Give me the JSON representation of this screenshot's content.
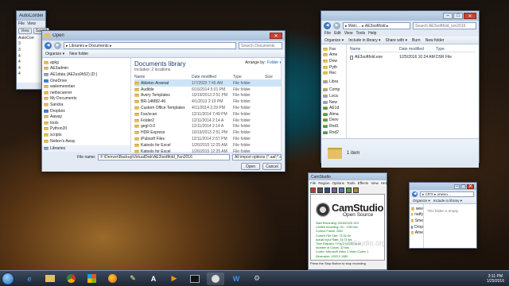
{
  "aux_window": {
    "title": "AutoCorder",
    "menu": [
      "File",
      "View"
    ],
    "tabs": [
      "View",
      "Saved"
    ],
    "tree": [
      "AutoCorr",
      "3",
      "3",
      "4",
      "4",
      "4",
      "4"
    ]
  },
  "open_dialog": {
    "title": "Open",
    "breadcrumb": "▸ Libraries ▸ Documents ▸",
    "search_placeholder": "Search Documents",
    "toolbar": {
      "organize": "Organize ▾",
      "new_folder": "New folder"
    },
    "nav_items": [
      "apkg",
      "AE3admin",
      "AE1data (AE2us9h52) (D:)",
      "OneDrive",
      "wakemeontan",
      "netbscanner",
      "My Documents",
      "Sandra",
      "Dropbox",
      "Aaway",
      "tools",
      "Python20",
      "scripts",
      "Netton's Away"
    ],
    "libraries_label": "Libraries",
    "library": {
      "title": "Documents library",
      "subtitle": "Includes: 2 locations",
      "arrange_label": "Arrange by:",
      "arrange_value": "Folder ▾"
    },
    "columns": [
      "Name",
      "Date modified",
      "Type",
      "Size"
    ],
    "files": [
      {
        "name": "Ableton Arsenal",
        "date": "1/7/2020 7:45 AM",
        "type": "File folder"
      },
      {
        "name": "Audible",
        "date": "6/16/2014 5:01 PM",
        "type": "File folder"
      },
      {
        "name": "Avery Templates",
        "date": "10/19/2013 2:51 PM",
        "type": "File folder"
      },
      {
        "name": "BR-14M82-46",
        "date": "4/1/2013 2:19 PM",
        "type": "File folder"
      },
      {
        "name": "Custom Office Templates",
        "date": "4/11/2014 2:29 PM",
        "type": "File folder"
      },
      {
        "name": "Fax/scan",
        "date": "12/11/2014 7:49 PM",
        "type": "File folder"
      },
      {
        "name": "Folder2",
        "date": "12/11/2014 2:14 A",
        "type": "File folder"
      },
      {
        "name": "gegl-0.0",
        "date": "12/11/2014 2:14 A",
        "type": "File folder"
      },
      {
        "name": "HDR Express",
        "date": "10/19/2013 2:51 PM",
        "type": "File folder"
      },
      {
        "name": "iPubsoft Files",
        "date": "12/11/2014 2:57 PM",
        "type": "File folder"
      },
      {
        "name": "Katools for Excel",
        "date": "1/26/2015 12:25 AM",
        "type": "File folder"
      },
      {
        "name": "Katools for Excel",
        "date": "1/26/2015 12:25 AM",
        "type": "File folder"
      }
    ],
    "filename_label": "File name:",
    "filename_value": "F:\\Denver\\Backup\\VirtualDisk\\AE3\\softfold_f\\sn2016",
    "filetype_value": "All import options (*.aaf;*.aaw ▾",
    "open_label": "Open",
    "cancel_label": "Cancel"
  },
  "explorer_right": {
    "title": "Welc…",
    "breadcrumb": "▸ Welc… ▸ AE3softfold ▸",
    "search_placeholder": "Search AE3softfold_ton2016",
    "toolbar": [
      "Organize ▾",
      "Include in library ▾",
      "Share with ▾",
      "Burn",
      "New folder"
    ],
    "nav_items": [
      "Fav",
      "Ame",
      "Dow",
      "Pyth",
      "Rec",
      "Libra",
      "Comp",
      "Loca",
      "New",
      "AE1d",
      "Atma",
      "Denv",
      "Rnd1",
      "Rnd2"
    ],
    "columns": [
      "Name",
      "Date modified",
      "Type"
    ],
    "file": {
      "name": "AE3softfold.exe",
      "date": "1/25/2016 10:24 AM",
      "type": "DSR File"
    },
    "status": "1 item"
  },
  "camstudio": {
    "title": "CamStudio",
    "menu": [
      "File",
      "Region",
      "Options",
      "Tools",
      "Effects",
      "View",
      "Help"
    ],
    "logo_main": "CamStudio",
    "logo_sub": "Open Source",
    "stats": [
      "Start Recording: 2016/01/25 10:0",
      "Limited recording: On : 1780 sec",
      "Current Frame: 2002",
      "Current File Size: 75.92 Kb",
      "Actual Input Rate: 19.74 fps",
      "Time Elapsed: 0 hrs 0 min 56 secs",
      "Number of Colors: 32 bits",
      "Codec: Microsoft Video 1 Video Codec 1",
      "Dimension: 1920 X 1080"
    ],
    "status": "Press the Stop Button to stop recording",
    "watermark": "CamStudio.org"
  },
  "small_window": {
    "breadcrumb": "▸ CR'S ▸ unwoo…",
    "toolbar": [
      "Organize ▾",
      "Include in library ▾"
    ],
    "nav_items": [
      "wee",
      "natfy",
      "Sme",
      "Drop",
      "Ame"
    ],
    "empty_text": "This folder is empty."
  },
  "taskbar": {
    "time": "3:11 PM",
    "date": "1/25/2016",
    "icons": [
      "ie-icon",
      "folder-icon",
      "chrome-icon",
      "ms-icon",
      "firefox-icon",
      "paint-icon",
      "a-icon",
      "media-icon",
      "cmd-icon",
      "camstudio-icon",
      "word-icon",
      "tool-icon"
    ]
  },
  "colors": {
    "accent": "#1e5fa8",
    "folder": "#e4c062",
    "selection": "#cce4f7"
  }
}
